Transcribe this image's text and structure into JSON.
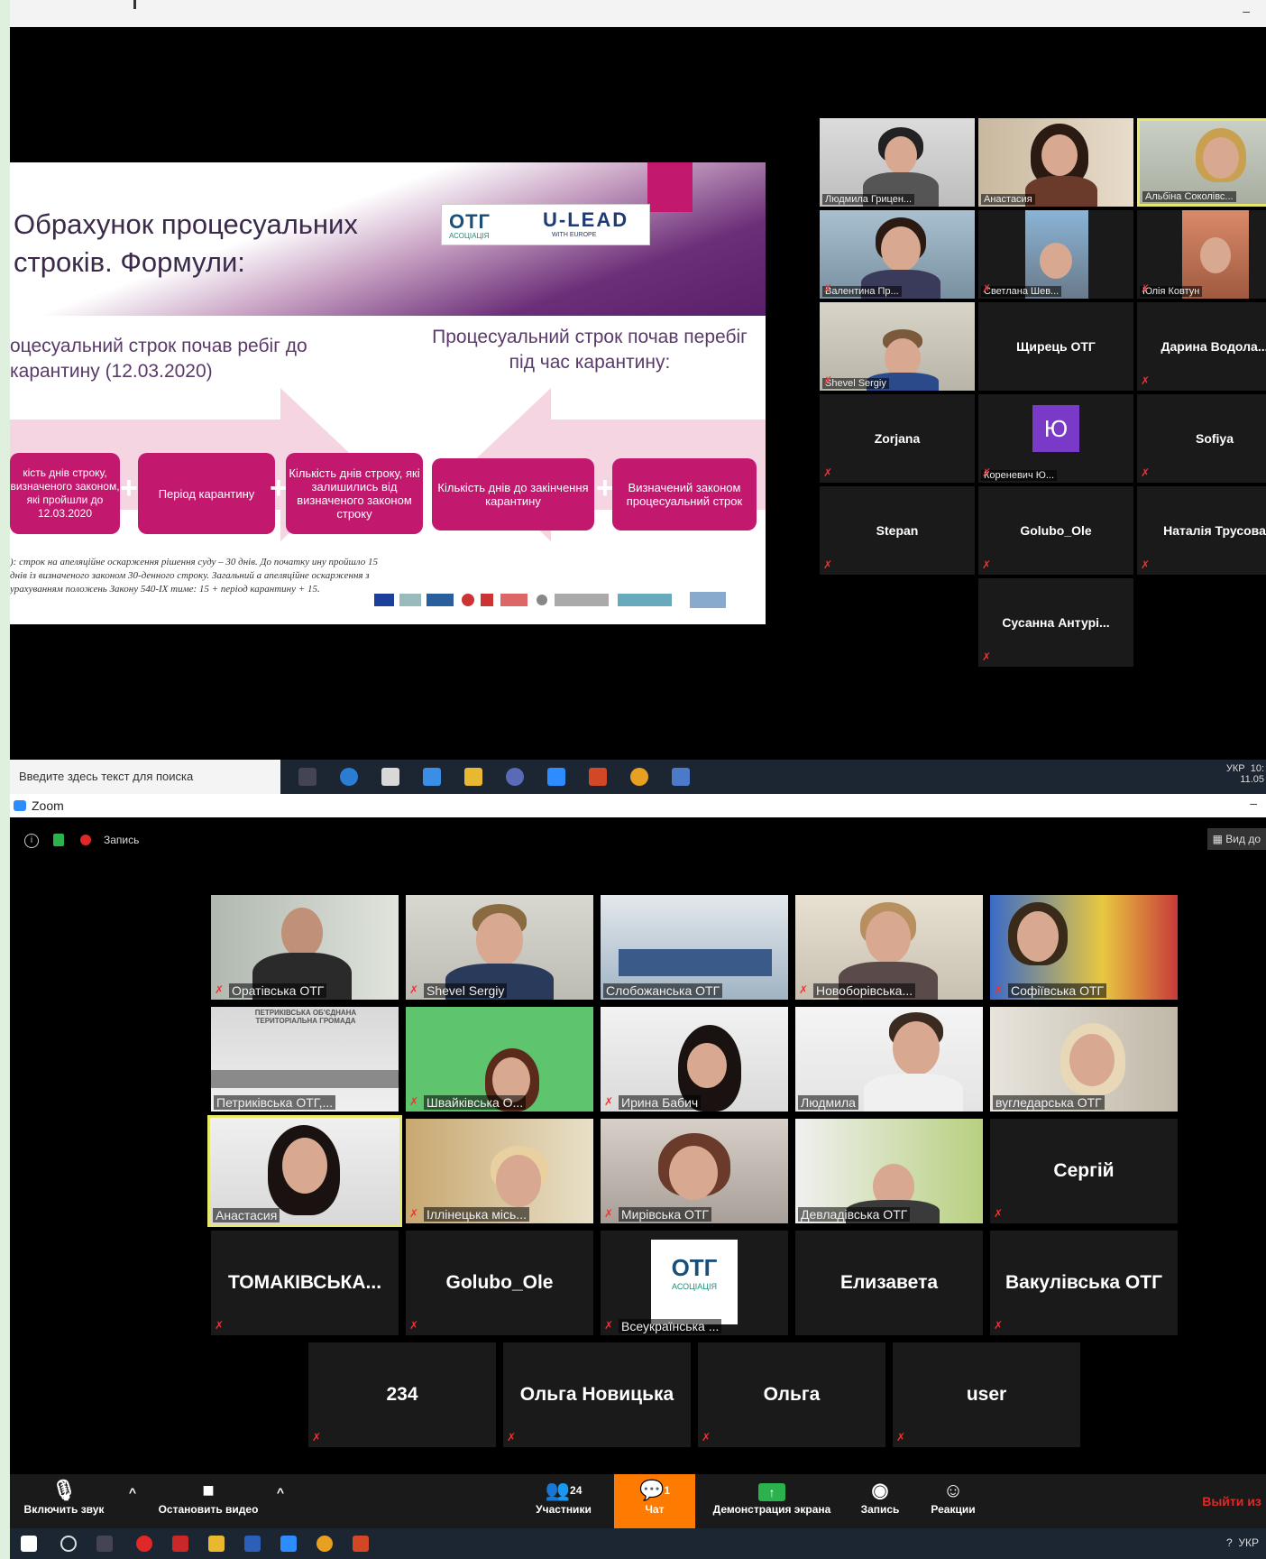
{
  "top": {
    "slide": {
      "title": "Обрахунок процесуальних строків. Формули:",
      "logo_otg": "ОТГ",
      "logo_otg_sub": "АСОЦІАЦІЯ",
      "logo_ulead": "U-LEAD",
      "logo_ulead_sub": "WITH EUROPE",
      "left_heading": "оцесуальний строк почав ребіг до карантину (12.03.2020)",
      "right_heading": "Процесуальний строк почав перебіг під час карантину:",
      "box1": "кість днів строку, визначеного законом, які пройшли до 12.03.2020",
      "box2": "Період карантину",
      "box3": "Кількість днів строку, які залишились від визначеного законом строку",
      "box4": "Кількість днів до закінчення карантину",
      "box5": "Визначений законом процесуальний строк",
      "plus": "+",
      "note": "): строк на апеляційне оскарження рішення суду – 30 днів. До початку ину пройшло 15 днів із визначеного законом 30-денного строку. Загальний а апеляційне оскарження з урахуванням положень Закону 540-IX тиме: 15 + період карантину + 15."
    },
    "participants": [
      {
        "name": "Людмила Грицен..."
      },
      {
        "name": "Анастасия"
      },
      {
        "name": "Альбіна Соколівс..."
      },
      {
        "name": "Валентина Пр..."
      },
      {
        "name": "Светлана Шев..."
      },
      {
        "name": "Юлія Ковтун"
      },
      {
        "name": "Shevel Sergiy"
      },
      {
        "name": "Щирець ОТГ"
      },
      {
        "name": "Дарина Водола..."
      },
      {
        "name": "Zorjana"
      },
      {
        "name": "Кореневич Ю..."
      },
      {
        "name": "Sofiya"
      },
      {
        "name": "Stepan"
      },
      {
        "name": "Golubo_Ole"
      },
      {
        "name": "Наталія Трусова"
      },
      {
        "name": "Сусанна Антурі..."
      }
    ],
    "avatar_letter": "Ю",
    "taskbar": {
      "search_placeholder": "Введите здесь текст для поиска",
      "lang": "УКР",
      "time": "10:",
      "date": "11.05"
    }
  },
  "bottom": {
    "window_title": "Zoom",
    "recording_label": "Запись",
    "view_label": "Вид до",
    "participants": [
      {
        "name": "Оратівська ОТГ"
      },
      {
        "name": "Shevel Sergiy"
      },
      {
        "name": "Слобожанська ОТГ"
      },
      {
        "name": "Новоборівська..."
      },
      {
        "name": "Софіївська ОТГ"
      },
      {
        "name": "Петриківська ОТГ,..."
      },
      {
        "name": "Швайківська О..."
      },
      {
        "name": "Ирина Бабич"
      },
      {
        "name": "Людмила"
      },
      {
        "name": "вугледарська ОТГ"
      },
      {
        "name": "Анастасия"
      },
      {
        "name": "Іллінецька місь..."
      },
      {
        "name": "Мирівська ОТГ"
      },
      {
        "name": "Девладівська ОТГ"
      },
      {
        "name": "Сергій"
      },
      {
        "name": "ТОМАКІВСЬКА..."
      },
      {
        "name": "Golubo_Ole"
      },
      {
        "name": "Всеукраїнська ..."
      },
      {
        "name": "Елизавета"
      },
      {
        "name": "Вакулівська ОТГ"
      },
      {
        "name": "234"
      },
      {
        "name": "Ольга Новицька"
      },
      {
        "name": "Ольга"
      },
      {
        "name": "user"
      }
    ],
    "room_sign": "ПЕТРИКІВСЬКА ОБ'ЄДНАНА ТЕРИТОРІАЛЬНА ГРОМАДА",
    "otg_logo": "ОТГ",
    "otg_logo_sub": "АСОЦІАЦІЯ",
    "toolbar": {
      "unmute": "Включить звук",
      "stop_video": "Остановить видео",
      "participants": "Участники",
      "participants_count": "24",
      "chat": "Чат",
      "chat_badge": "1",
      "share": "Демонстрация экрана",
      "record": "Запись",
      "reactions": "Реакции",
      "leave": "Выйти из"
    },
    "taskbar": {
      "lang": "УКР"
    }
  },
  "colors": {
    "zoom_blue": "#2d8cff",
    "chat_orange": "#ff7a00",
    "leave_red": "#e02828",
    "slide_magenta": "#c2186d",
    "active_border": "#e8e86a"
  }
}
